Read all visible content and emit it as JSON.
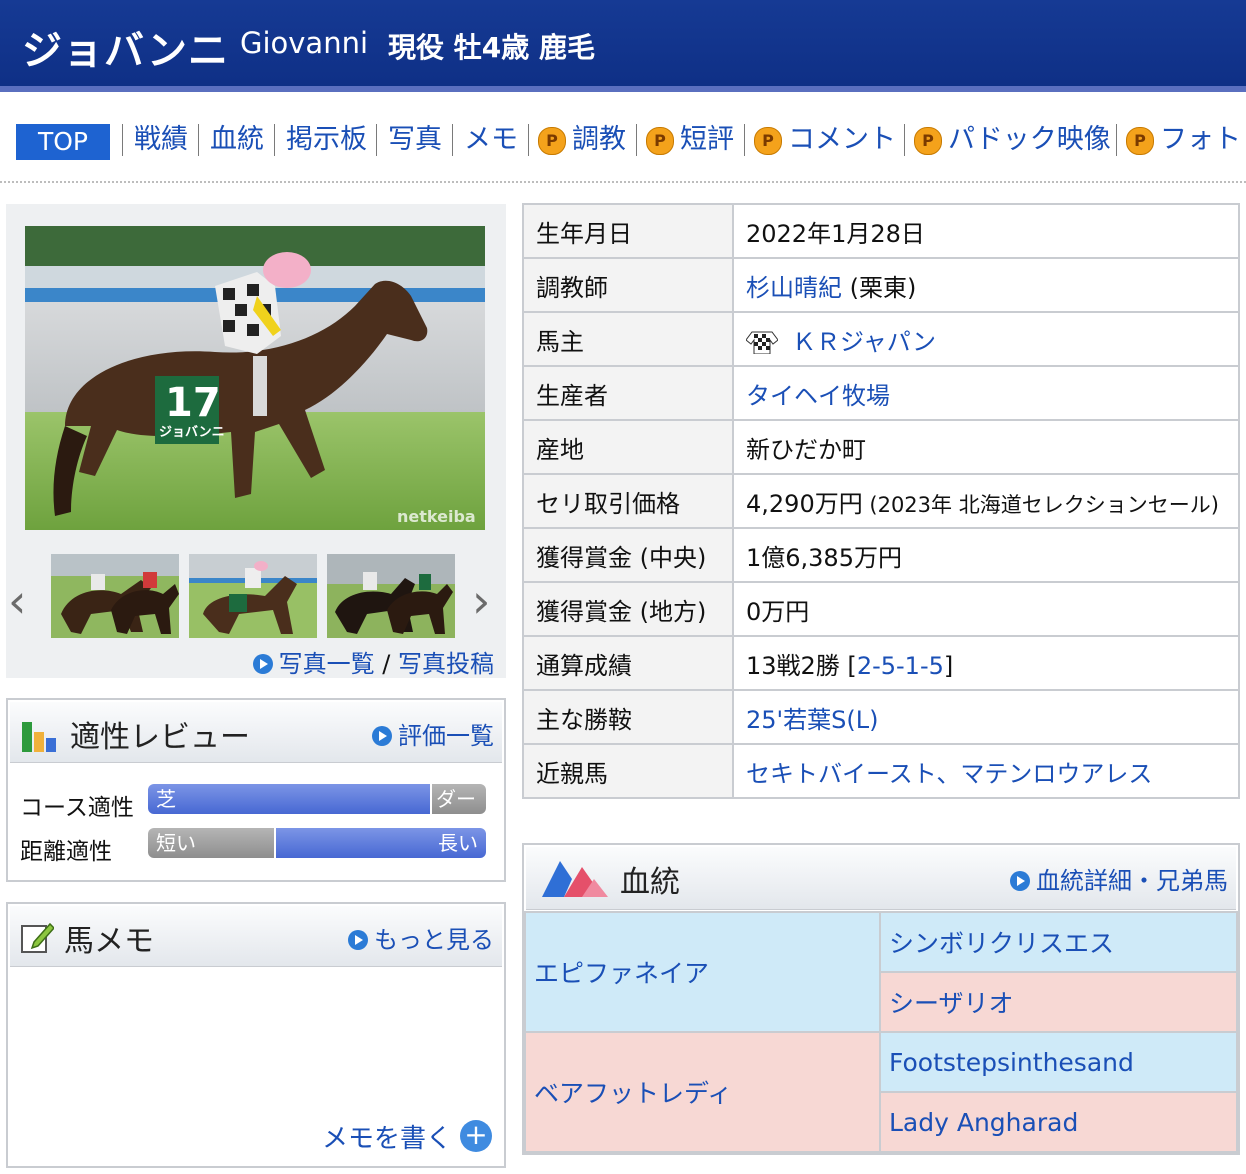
{
  "header": {
    "name_ja": "ジョバンニ",
    "name_en": "Giovanni",
    "status": "現役 牡4歳 鹿毛"
  },
  "nav": {
    "top": "TOP",
    "items": [
      "戦績",
      "血統",
      "掲示板",
      "写真",
      "メモ",
      "調教",
      "短評",
      "コメント",
      "パドック映像",
      "フォト"
    ],
    "premium_badge": "P"
  },
  "photos": {
    "watermark": "netkeiba",
    "bib_number": "17",
    "bib_name": "ジョバンニ",
    "links": {
      "list": "写真一覧",
      "sep": " / ",
      "post": "写真投稿"
    },
    "prev_arrow": "‹",
    "next_arrow": "›"
  },
  "aptitude": {
    "title": "適性レビュー",
    "link": "評価一覧",
    "course_label": "コース適性",
    "course_left": "芝",
    "course_right": "ダート",
    "course_left_share": 0.84,
    "distance_label": "距離適性",
    "distance_left": "短い",
    "distance_right": "長い",
    "distance_left_share": 0.38
  },
  "memo": {
    "title": "馬メモ",
    "link": "もっと見る",
    "write": "メモを書く"
  },
  "info": {
    "birth_label": "生年月日",
    "birth": "2022年1月28日",
    "trainer_label": "調教師",
    "trainer": "杉山晴紀",
    "trainer_suffix": " (栗東)",
    "owner_label": "馬主",
    "owner": "ＫＲジャパン",
    "breeder_label": "生産者",
    "breeder": "タイヘイ牧場",
    "origin_label": "産地",
    "origin": "新ひだか町",
    "auction_label": "セリ取引価格",
    "auction": "4,290万円",
    "auction_note": " (2023年 北海道セレクションセール)",
    "prize_central_label": "獲得賞金 (中央)",
    "prize_central": "1億6,385万円",
    "prize_local_label": "獲得賞金 (地方)",
    "prize_local": "0万円",
    "record_label": "通算成績",
    "record_prefix": "13戦2勝 [",
    "record_link": "2-5-1-5",
    "record_suffix": "]",
    "main_win_label": "主な勝鞍",
    "main_win": "25'若葉S(L)",
    "relatives_label": "近親馬",
    "relative1": "セキトバイースト",
    "relative_sep": "、",
    "relative2": "マテンロウアレス"
  },
  "pedigree": {
    "title": "血統",
    "link": "血統詳細・兄弟馬",
    "sire": "エピファネイア",
    "dam": "ベアフットレディ",
    "sire_sire": "シンボリクリスエス",
    "sire_dam": "シーザリオ",
    "dam_sire": "Footstepsinthesand",
    "dam_dam": "Lady Angharad"
  },
  "colors": {
    "header": "#163a94",
    "link": "#1a4fb6",
    "male": "#cfeaf8",
    "female": "#f7d8d4",
    "tab": "#1e63d1"
  }
}
